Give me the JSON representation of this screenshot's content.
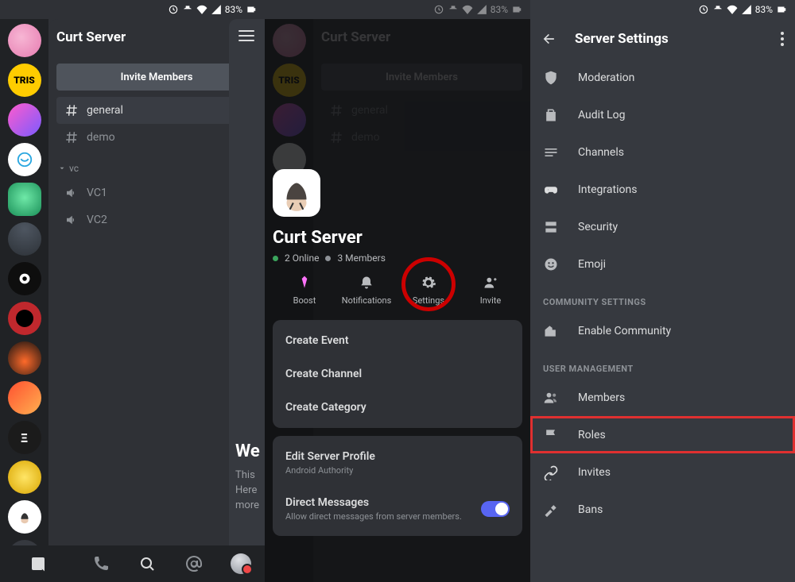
{
  "status": {
    "battery": "83%"
  },
  "phone1": {
    "server_title": "Curt Server",
    "invite_label": "Invite Members",
    "channels": {
      "general": "general",
      "demo": "demo"
    },
    "vc_category": "vc",
    "vc": {
      "vc1": "VC1",
      "vc2": "VC2"
    },
    "welcome_title": "We",
    "welcome_l1": "This",
    "welcome_l2": "Here",
    "welcome_l3": "more"
  },
  "phone2": {
    "server_title": "Curt Server",
    "online": "2 Online",
    "members": "3 Members",
    "actions": {
      "boost": "Boost",
      "notifications": "Notifications",
      "settings": "Settings",
      "invite": "Invite"
    },
    "menu": {
      "create_event": "Create Event",
      "create_channel": "Create Channel",
      "create_category": "Create Category",
      "edit_profile": "Edit Server Profile",
      "edit_profile_sub": "Android Authority",
      "dm": "Direct Messages",
      "dm_sub": "Allow direct messages from server members."
    }
  },
  "phone3": {
    "title": "Server Settings",
    "items": {
      "moderation": "Moderation",
      "audit": "Audit Log",
      "channels": "Channels",
      "integrations": "Integrations",
      "security": "Security",
      "emoji": "Emoji"
    },
    "community_header": "COMMUNITY SETTINGS",
    "enable_community": "Enable Community",
    "user_header": "USER MANAGEMENT",
    "user": {
      "members": "Members",
      "roles": "Roles",
      "invites": "Invites",
      "bans": "Bans"
    }
  }
}
